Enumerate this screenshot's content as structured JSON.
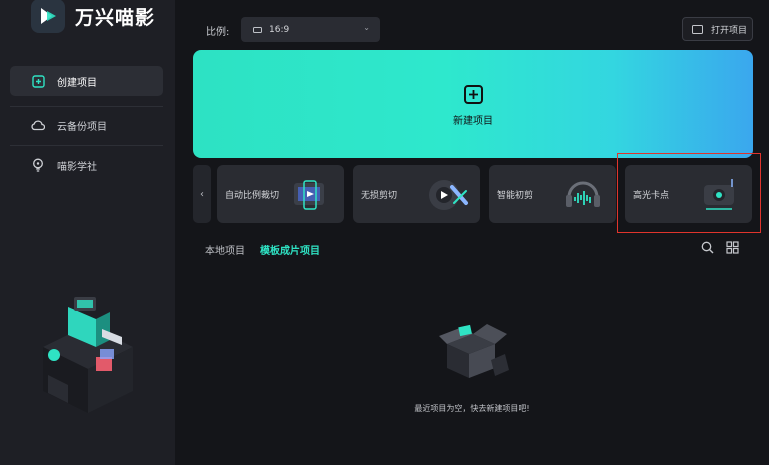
{
  "app": {
    "name": "万兴喵影",
    "colors": {
      "accent": "#2fe3c4",
      "sidebar_bg": "#1e1f25",
      "main_bg": "#141519",
      "highlight": "#e0342c"
    }
  },
  "sidebar": {
    "items": [
      {
        "label": "创建项目",
        "icon": "plus-square-icon",
        "active": true
      },
      {
        "label": "云备份项目",
        "icon": "cloud-icon",
        "active": false
      },
      {
        "label": "喵影学社",
        "icon": "lightbulb-icon",
        "active": false
      }
    ]
  },
  "toolbar": {
    "ratio_label": "比例:",
    "ratio_value": "16:9",
    "open_project_label": "打开项目"
  },
  "new_project": {
    "label": "新建项目"
  },
  "tools": [
    {
      "label": "自动比例裁切",
      "icon": "auto-reframe-icon"
    },
    {
      "label": "无损剪切",
      "icon": "lossless-cut-icon"
    },
    {
      "label": "智能初剪",
      "icon": "smart-cut-icon"
    },
    {
      "label": "高光卡点",
      "icon": "highlight-beat-icon"
    }
  ],
  "tabs": {
    "local": "本地项目",
    "template": "模板成片项目"
  },
  "empty_state": {
    "message": "最近项目为空，快去新建项目吧!"
  }
}
